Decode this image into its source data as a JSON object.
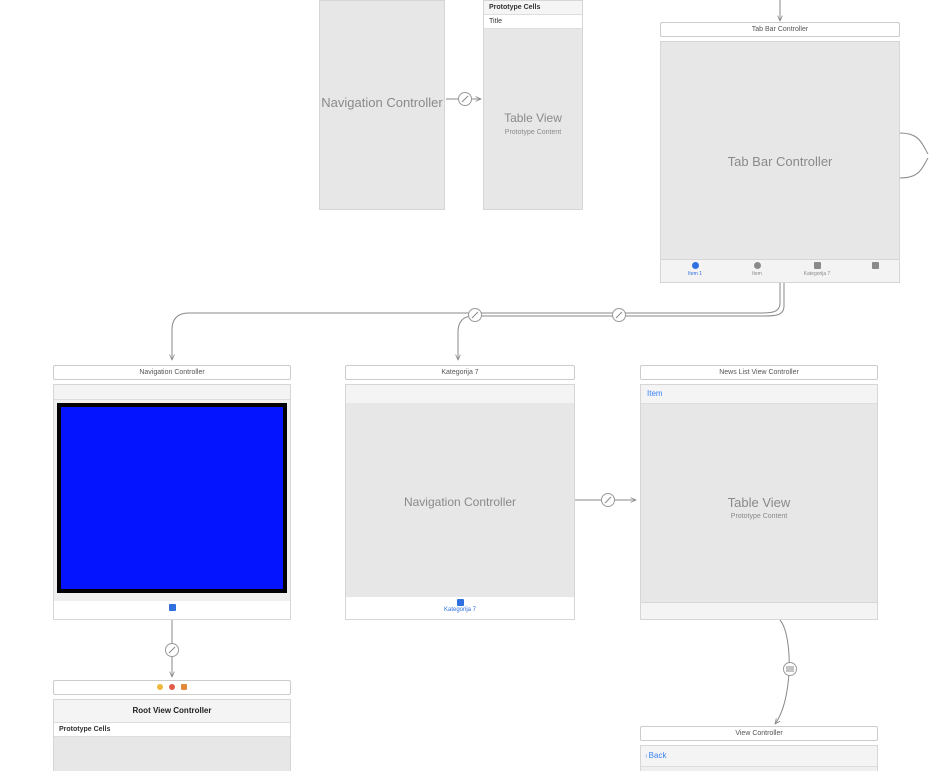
{
  "top_nav": {
    "title": "Navigation Controller"
  },
  "top_table": {
    "proto_label": "Prototype Cells",
    "row_label": "Title",
    "title": "Table View",
    "subtitle": "Prototype Content"
  },
  "tabbar_scene": {
    "titlebar": "Tab Bar Controller",
    "title": "Tab Bar Controller",
    "tabs": [
      {
        "label": "Item 1",
        "selected": true,
        "shape": "circle"
      },
      {
        "label": "Item",
        "selected": false,
        "shape": "circle"
      },
      {
        "label": "Kategorija 7",
        "selected": false,
        "shape": "square"
      },
      {
        "label": "",
        "selected": false,
        "shape": "square"
      }
    ]
  },
  "mid_nav_blue": {
    "titlebar": "Navigation Controller",
    "tab_label": ""
  },
  "root_vc": {
    "title": "Root View Controller",
    "proto_label": "Prototype Cells"
  },
  "mid_nav_kat": {
    "titlebar": "Kategorija 7",
    "title": "Navigation Controller",
    "tab_label": "Kategorija 7"
  },
  "news_list": {
    "titlebar": "News List View Controller",
    "item_label": "Item",
    "title": "Table View",
    "subtitle": "Prototype Content"
  },
  "bottom_vc": {
    "titlebar": "View Controller",
    "back_label": "Back"
  }
}
